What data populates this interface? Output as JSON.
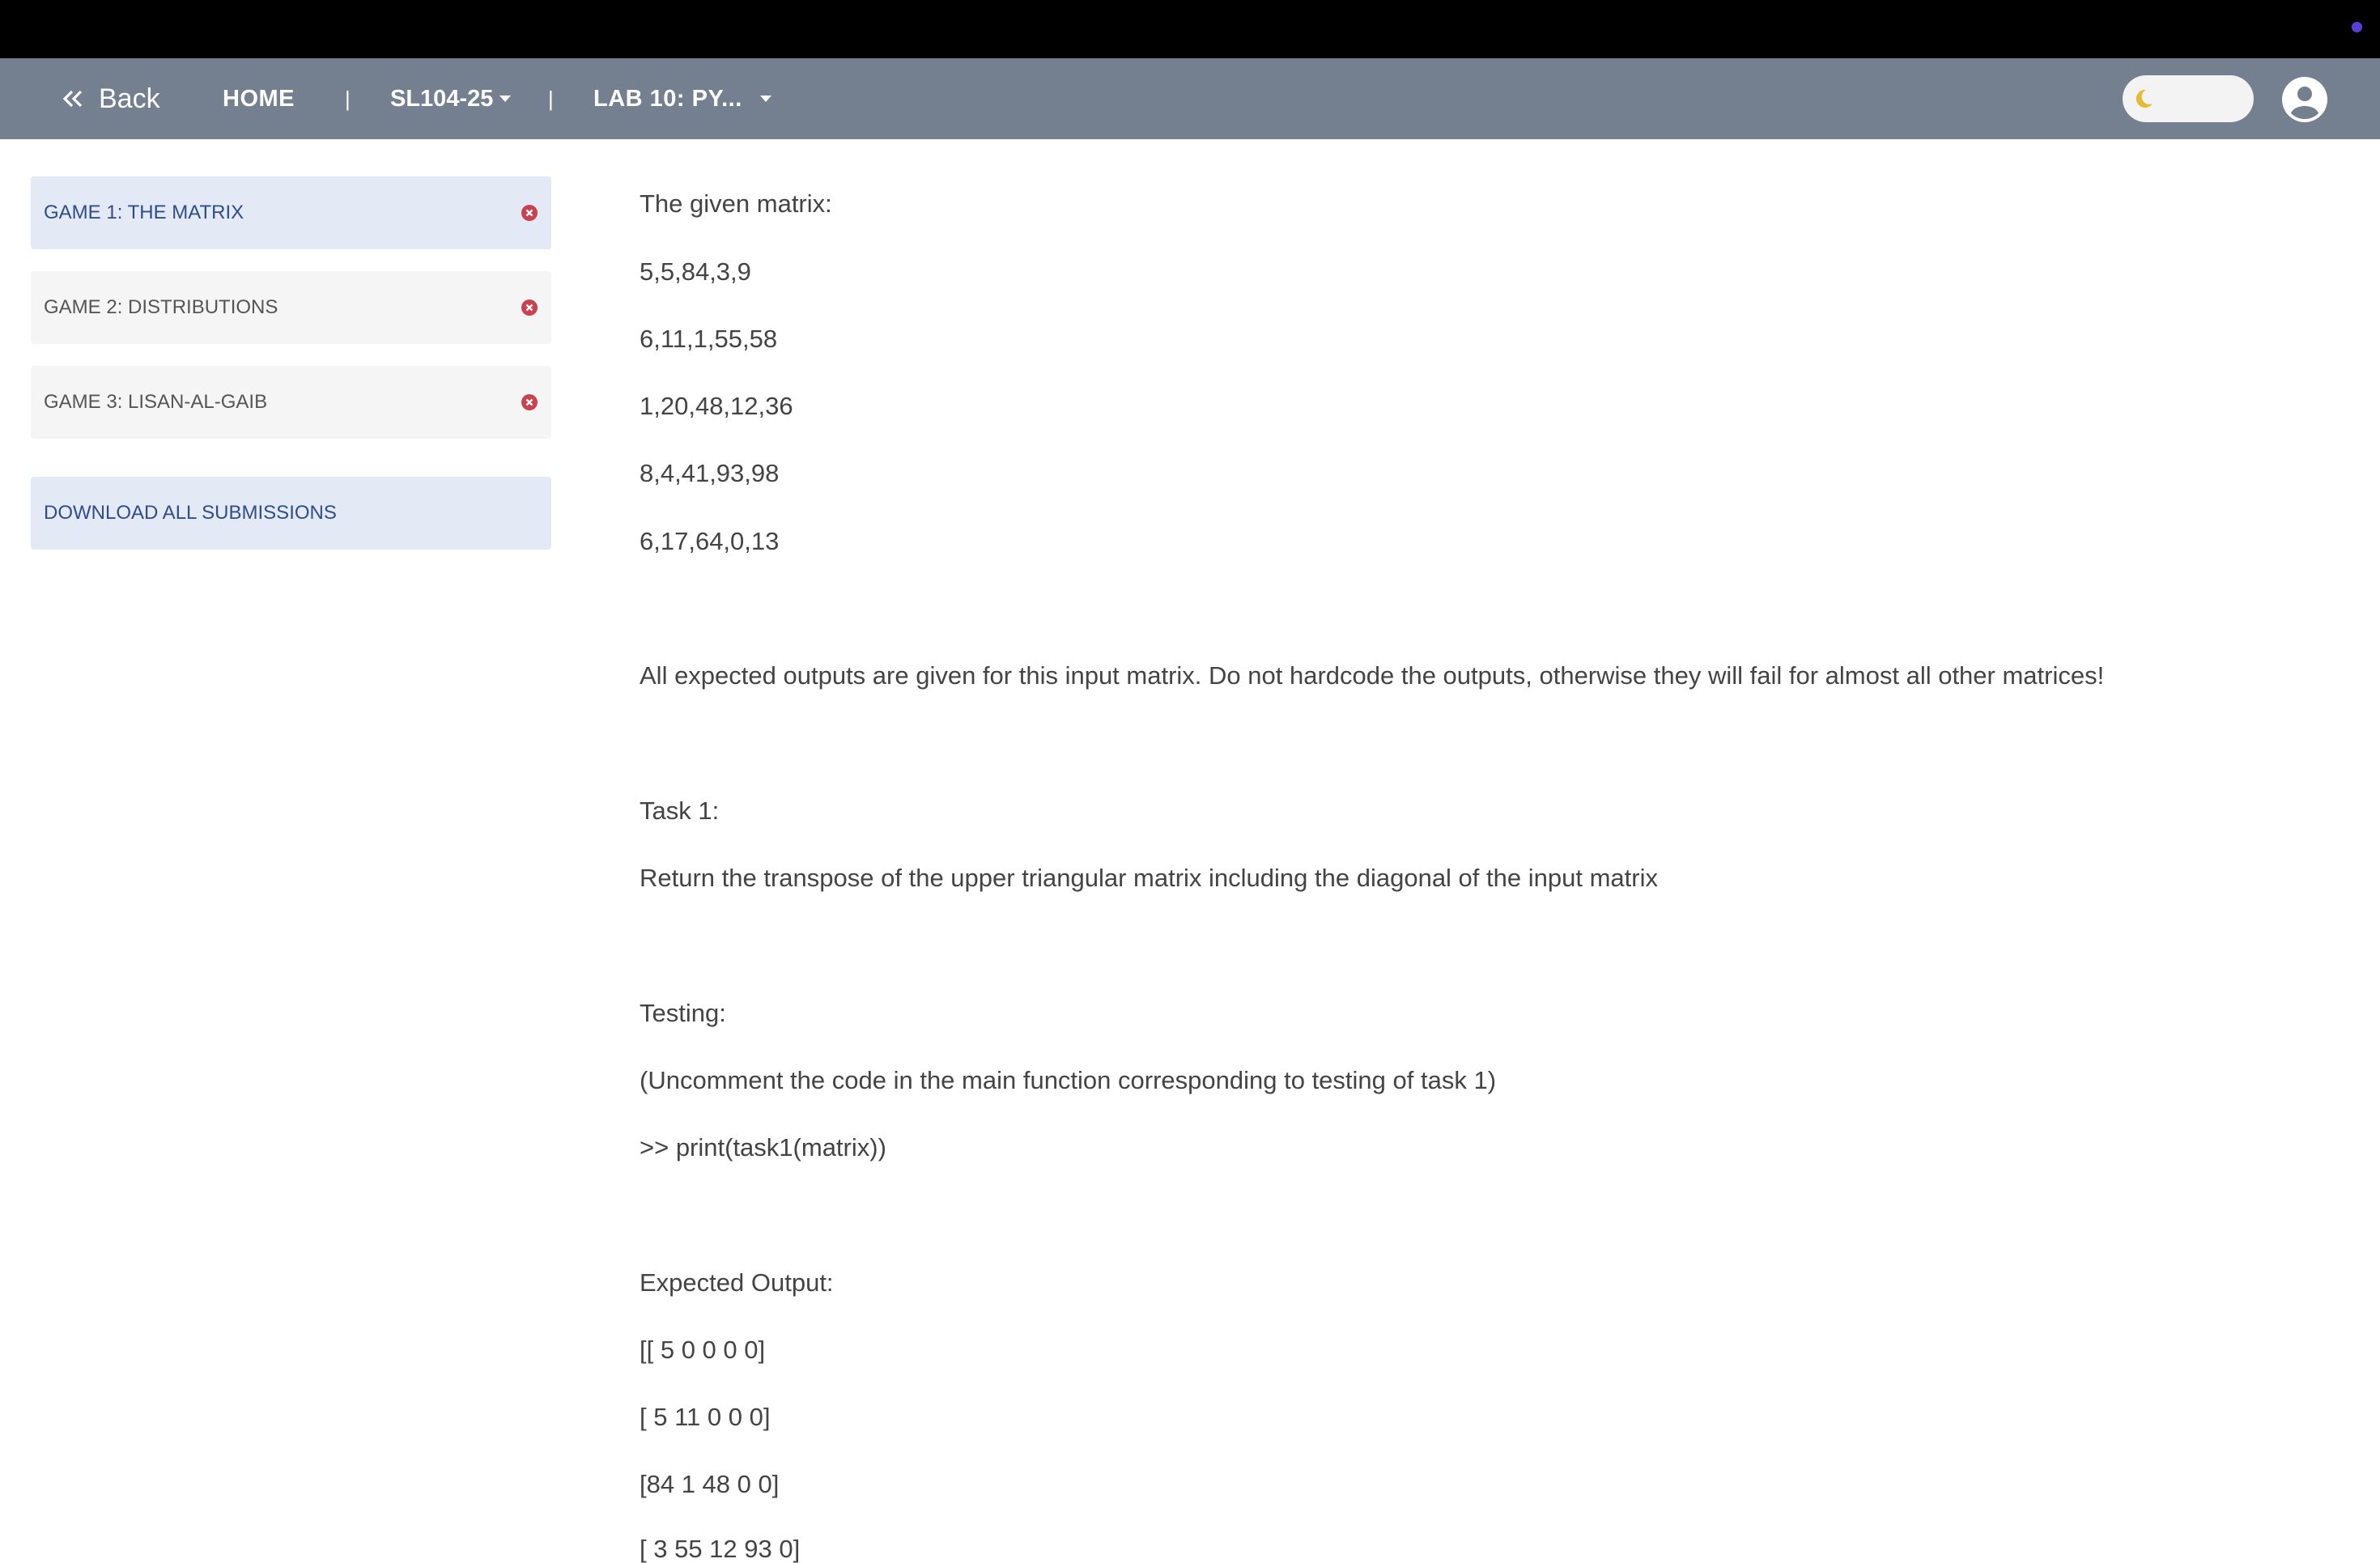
{
  "nav": {
    "back_label": "Back",
    "home_label": "HOME",
    "separator": "|",
    "course_label": "SL104-25",
    "lab_label": "LAB 10: PY..."
  },
  "sidebar": {
    "items": [
      {
        "label": "GAME 1: THE MATRIX",
        "active": true
      },
      {
        "label": "GAME 2: DISTRIBUTIONS",
        "active": false
      },
      {
        "label": "GAME 3: LISAN-AL-GAIB",
        "active": false
      }
    ],
    "download_label": "DOWNLOAD ALL SUBMISSIONS"
  },
  "content": {
    "lines": [
      "The given matrix:",
      "5,5,84,3,9",
      "6,11,1,55,58",
      "1,20,48,12,36",
      "8,4,41,93,98",
      "6,17,64,0,13",
      "All expected outputs are given for this input matrix. Do not hardcode the outputs, otherwise they will fail for almost all other matrices!",
      "Task 1:",
      "Return the transpose of the upper triangular matrix including the diagonal of the input matrix",
      "Testing:",
      "(Uncomment the code in the main function corresponding to testing of task 1)",
      ">> print(task1(matrix))",
      "Expected Output:",
      "[[ 5 0 0 0 0]",
      "[ 5 11 0 0 0]",
      "[84 1 48 0 0]",
      "[ 3 55 12 93 0]"
    ]
  },
  "colors": {
    "navbar": "#74808f",
    "active_bg": "#e4e9f6",
    "active_text": "#2f4d89",
    "close_icon": "#c8424f",
    "moon": "#e8b931"
  },
  "icons": [
    "double-chevron-left-icon",
    "caret-down-icon",
    "moon-icon",
    "user-circle-icon",
    "close-circle-icon"
  ]
}
